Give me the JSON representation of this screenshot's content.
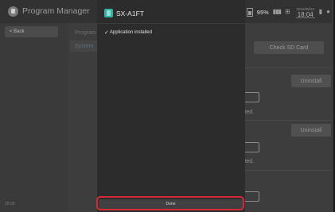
{
  "topbar": {
    "app_title": "Program Manager",
    "battery_percent": "95%",
    "date": "2015/05/22",
    "time": "18:04"
  },
  "sidebar": {
    "back_label": "< Back",
    "tabs": [
      {
        "label": "Program"
      },
      {
        "label": "System"
      }
    ],
    "clock_label": "18:00"
  },
  "content": {
    "check_sd_label": "Check SD Card",
    "uninstall_label": "Uninstall",
    "activated_text": "vated."
  },
  "dialog": {
    "title": "SX-A1FT",
    "message": "Application installed",
    "done_label": "Done",
    "icon_color": "#2fb3a3"
  },
  "colors": {
    "highlight": "#d7283a",
    "background": "#3d3d3d",
    "dialog_bg": "#2c2c2c"
  }
}
